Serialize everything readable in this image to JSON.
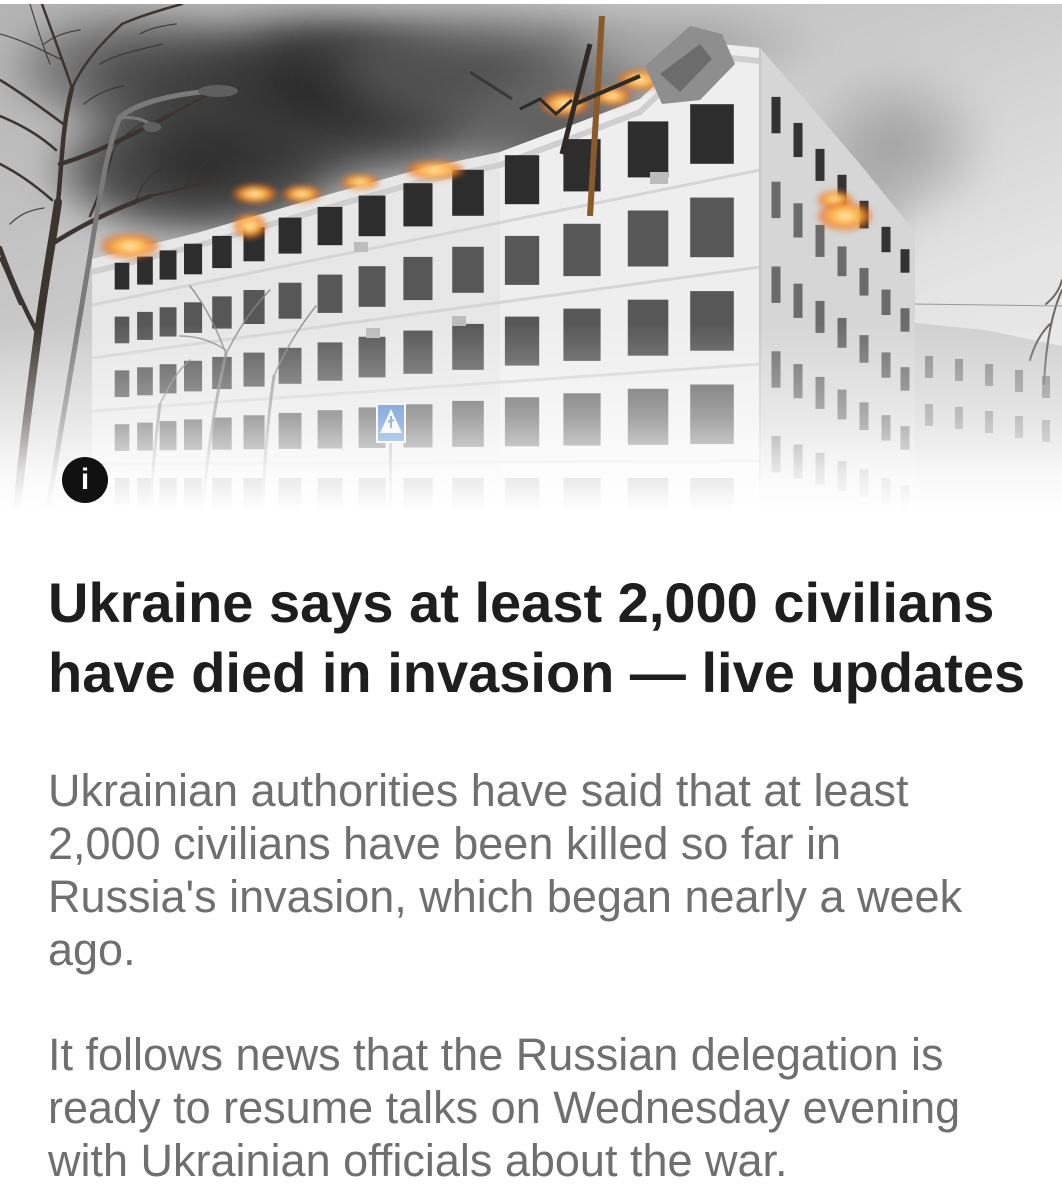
{
  "article": {
    "info_button": {
      "icon": "info-icon",
      "glyph": "i"
    },
    "headline": "Ukraine says at least 2,000 civilians have died in invasion — live updates",
    "paragraphs": [
      "Ukrainian authorities have said that at least 2,000 civilians have been killed so far in Russia's invasion, which began nearly a week ago.",
      "It follows news that the Russian delegation is ready to resume talks on Wednesday evening with Ukrainian officials about the war."
    ]
  },
  "colors": {
    "background": "#ffffff",
    "headline": "#1e1e1e",
    "body_text": "#6f6f6f",
    "info_button_bg": "#111111",
    "info_button_glyph": "#ffffff"
  }
}
